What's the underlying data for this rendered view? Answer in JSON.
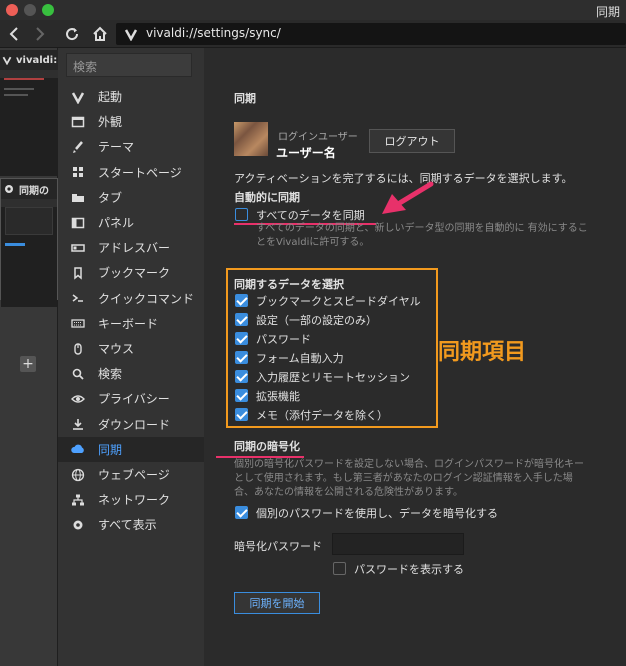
{
  "window": {
    "title": "同期"
  },
  "address_bar": {
    "url": "vivaldi://settings/sync/"
  },
  "tabs": [
    {
      "label": "vivaldi:"
    },
    {
      "label": "同期の"
    }
  ],
  "settings_nav": {
    "search_placeholder": "検索",
    "items": [
      {
        "label": "起動",
        "icon": "vivaldi-icon"
      },
      {
        "label": "外観",
        "icon": "window-icon"
      },
      {
        "label": "テーマ",
        "icon": "brush-icon"
      },
      {
        "label": "スタートページ",
        "icon": "grid-icon"
      },
      {
        "label": "タブ",
        "icon": "tab-icon"
      },
      {
        "label": "パネル",
        "icon": "panel-icon"
      },
      {
        "label": "アドレスバー",
        "icon": "address-bar-icon"
      },
      {
        "label": "ブックマーク",
        "icon": "bookmark-icon"
      },
      {
        "label": "クイックコマンド",
        "icon": "quick-command-icon"
      },
      {
        "label": "キーボード",
        "icon": "keyboard-icon"
      },
      {
        "label": "マウス",
        "icon": "mouse-icon"
      },
      {
        "label": "検索",
        "icon": "search-icon"
      },
      {
        "label": "プライバシー",
        "icon": "eye-icon"
      },
      {
        "label": "ダウンロード",
        "icon": "download-icon"
      },
      {
        "label": "同期",
        "icon": "cloud-icon",
        "active": true
      },
      {
        "label": "ウェブページ",
        "icon": "globe-icon"
      },
      {
        "label": "ネットワーク",
        "icon": "network-icon"
      },
      {
        "label": "すべて表示",
        "icon": "gear-icon"
      }
    ]
  },
  "sync": {
    "section_title": "同期",
    "logged_in_user_label": "ログインユーザー",
    "username": "ユーザー名",
    "logout_button": "ログアウト",
    "instruction": "アクティベーションを完了するには、同期するデータを選択します。",
    "auto_sync_heading": "自動的に同期",
    "sync_all_label": "すべてのデータを同期",
    "sync_all_checked": false,
    "sync_all_desc": "すべてのデータの同期と、新しいデータ型の同期を自動的に 有効にすることをVivaldiに許可する。",
    "select_data_heading": "同期するデータを選択",
    "data_items": [
      {
        "label": "ブックマークとスピードダイヤル",
        "checked": true
      },
      {
        "label": "設定（一部の設定のみ）",
        "checked": true
      },
      {
        "label": "パスワード",
        "checked": true
      },
      {
        "label": "フォーム自動入力",
        "checked": true
      },
      {
        "label": "入力履歴とリモートセッション",
        "checked": true
      },
      {
        "label": "拡張機能",
        "checked": true
      },
      {
        "label": "メモ（添付データを除く）",
        "checked": true
      }
    ],
    "encryption_heading": "同期の暗号化",
    "encryption_desc": "個別の暗号化パスワードを設定しない場合、ログインパスワードが暗号化キーとして使用されます。もし第三者があなたのログイン認証情報を入手した場合、あなたの情報を公開される危険性があります。",
    "use_separate_password_label": "個別のパスワードを使用し、データを暗号化する",
    "use_separate_password_checked": true,
    "encryption_password_label": "暗号化パスワード",
    "encryption_password_value": "",
    "show_password_label": "パスワードを表示する",
    "show_password_checked": false,
    "start_sync_button": "同期を開始"
  },
  "annotations": {
    "sync_items_label": "同期項目"
  },
  "colors": {
    "accent": "#3a8dde",
    "annotation_orange": "#f29a1e",
    "annotation_pink": "#e8316a"
  }
}
